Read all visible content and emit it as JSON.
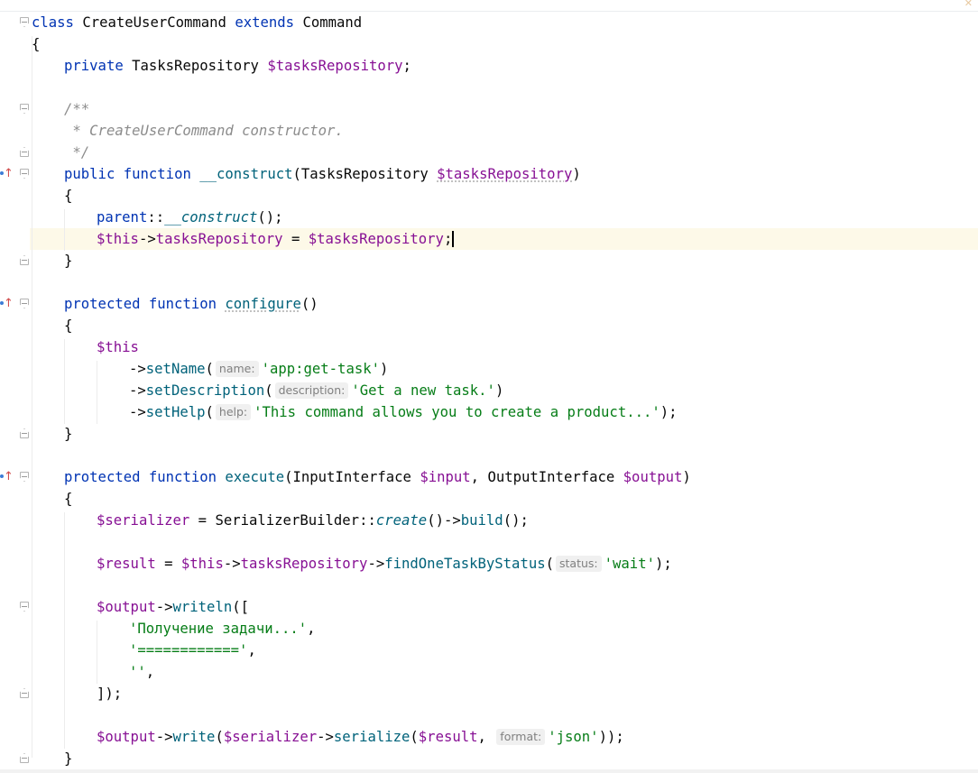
{
  "code": {
    "l1": {
      "kw1": "class",
      "name": "CreateUserCommand",
      "kw2": "extends",
      "parent": "Command"
    },
    "l2": "{",
    "l3": {
      "kw": "private",
      "type": "TasksRepository",
      "var": "$tasksRepository",
      "end": ";"
    },
    "l5": "/**",
    "l6": " * CreateUserCommand constructor.",
    "l7": " */",
    "l8": {
      "kw1": "public",
      "kw2": "function",
      "fn": "__construct",
      "open": "(",
      "type": "TasksRepository",
      "var": "$tasksRepository",
      "close": ")"
    },
    "l9": "{",
    "l10": {
      "kw": "parent",
      "sep": "::",
      "fn": "__construct",
      "end": "();"
    },
    "l11": {
      "this": "$this",
      "arrow": "->",
      "prop": "tasksRepository",
      "eq": " = ",
      "var": "$tasksRepository",
      "end": ";"
    },
    "l12": "}",
    "l14": {
      "kw1": "protected",
      "kw2": "function",
      "fn": "configure",
      "end": "()"
    },
    "l15": "{",
    "l16": "$this",
    "l17": {
      "arrow": "->",
      "fn": "setName",
      "open": "(",
      "hint": "name:",
      "str": "'app:get-task'",
      "close": ")"
    },
    "l18": {
      "arrow": "->",
      "fn": "setDescription",
      "open": "(",
      "hint": "description:",
      "str": "'Get a new task.'",
      "close": ")"
    },
    "l19": {
      "arrow": "->",
      "fn": "setHelp",
      "open": "(",
      "hint": "help:",
      "str": "'This command allows you to create a product...'",
      "close": ");"
    },
    "l20": "}",
    "l22": {
      "kw1": "protected",
      "kw2": "function",
      "fn": "execute",
      "open": "(",
      "t1": "InputInterface",
      "v1": "$input",
      "comma": ", ",
      "t2": "OutputInterface",
      "v2": "$output",
      "close": ")"
    },
    "l23": "{",
    "l24": {
      "var": "$serializer",
      "eq": " = ",
      "cls": "SerializerBuilder",
      "sep": "::",
      "st": "create",
      "mid": "()->",
      "fn": "build",
      "end": "();"
    },
    "l26": {
      "var": "$result",
      "eq": " = ",
      "this": "$this",
      "arrow": "->",
      "prop": "tasksRepository",
      "arrow2": "->",
      "fn": "findOneTaskByStatus",
      "open": "(",
      "hint": "status:",
      "str": "'wait'",
      "close": ");"
    },
    "l28": {
      "var": "$output",
      "arrow": "->",
      "fn": "writeln",
      "end": "(["
    },
    "l29": {
      "str": "'Получение задачи...'",
      "end": ","
    },
    "l30": {
      "str": "'============'",
      "end": ","
    },
    "l31": {
      "str": "''",
      "end": ","
    },
    "l32": "]);",
    "l34": {
      "var": "$output",
      "arrow": "->",
      "fn": "write",
      "open": "(",
      "var2": "$serializer",
      "arrow2": "->",
      "fn2": "serialize",
      "open2": "(",
      "var3": "$result",
      "comma": ", ",
      "hint": "format:",
      "str": "'json'",
      "close": "));"
    },
    "l35": "}"
  },
  "colors": {
    "keyword": "#0033b3",
    "function": "#00627a",
    "variable": "#871094",
    "string": "#067d17",
    "comment": "#8c8c8c",
    "caret_line": "#fdf9e8"
  },
  "icons": [
    "override-method-icon",
    "fold-icon",
    "x-icon"
  ]
}
